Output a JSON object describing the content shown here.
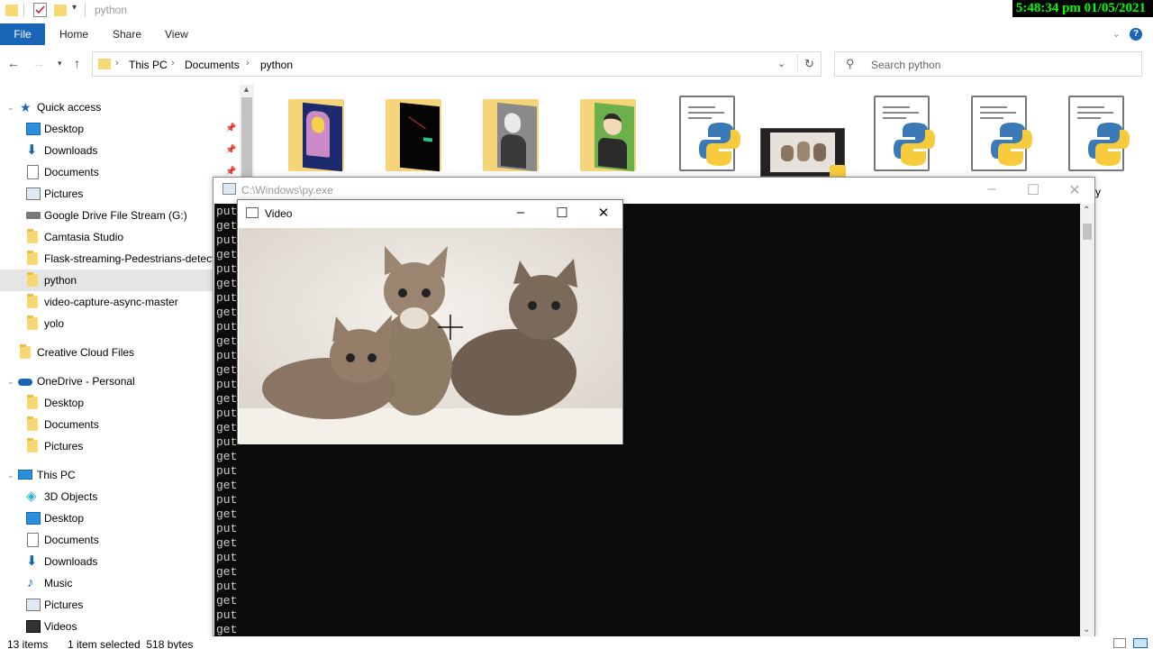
{
  "window": {
    "title": "python",
    "clock": "5:48:34 pm 01/05/2021"
  },
  "ribbon": {
    "tabs": [
      "File",
      "Home",
      "Share",
      "View"
    ]
  },
  "address": {
    "crumbs": [
      "This PC",
      "Documents",
      "python"
    ]
  },
  "search": {
    "placeholder": "Search python"
  },
  "sidebar": {
    "quick_access": "Quick access",
    "quick_items": [
      "Desktop",
      "Downloads",
      "Documents",
      "Pictures",
      "Google Drive File Stream (G:)",
      "Camtasia Studio",
      "Flask-streaming-Pedestrians-detecti",
      "python",
      "video-capture-async-master",
      "yolo"
    ],
    "creative_cloud": "Creative Cloud Files",
    "onedrive": "OneDrive - Personal",
    "onedrive_items": [
      "Desktop",
      "Documents",
      "Pictures"
    ],
    "this_pc": "This PC",
    "pc_items": [
      "3D Objects",
      "Desktop",
      "Documents",
      "Downloads",
      "Music",
      "Pictures",
      "Videos"
    ]
  },
  "files": {
    "partial_label": "cale.py"
  },
  "console": {
    "title": "C:\\Windows\\py.exe",
    "lines": [
      "put",
      "get",
      "put",
      "get",
      "put",
      "get",
      "put",
      "get",
      "put",
      "get",
      "put",
      "get",
      "put",
      "get",
      "put",
      "get",
      "put",
      "get",
      "put",
      "get",
      "put",
      "get",
      "put",
      "get",
      "put",
      "get",
      "put",
      "get",
      "put",
      "get"
    ]
  },
  "video": {
    "title": "Video"
  },
  "status": {
    "items": "13 items",
    "selection": "1 item selected  518 bytes"
  },
  "colors": {
    "accent": "#1a66b6",
    "clock_bg": "#000000",
    "clock_fg": "#00ff00",
    "console_bg": "#0c0c0c",
    "console_fg": "#cccccc"
  }
}
